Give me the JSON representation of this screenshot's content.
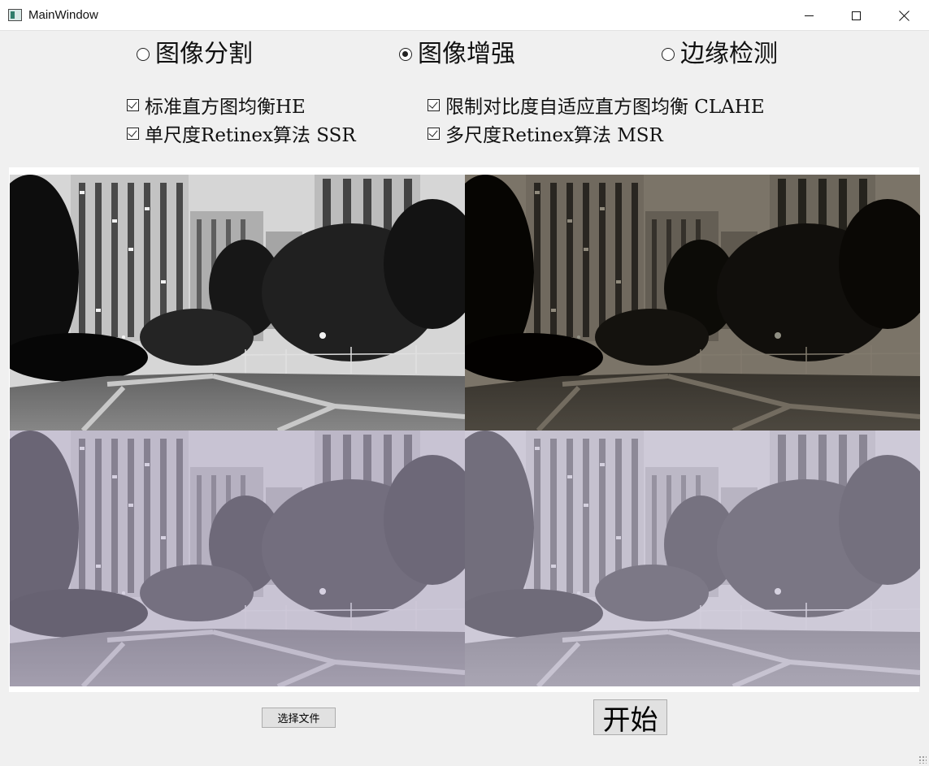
{
  "window": {
    "title": "MainWindow",
    "controls": [
      "minimize-icon",
      "maximize-icon",
      "close-icon"
    ]
  },
  "modes": [
    {
      "label": "图像分割",
      "checked": false
    },
    {
      "label": "图像增强",
      "checked": true
    },
    {
      "label": "边缘检测",
      "checked": false
    }
  ],
  "methods": [
    {
      "label": "标准直方图均衡HE",
      "checked": true
    },
    {
      "label": "限制对比度自适应直方图均衡 CLAHE",
      "checked": true
    },
    {
      "label": "单尺度Retinex算法 SSR",
      "checked": true
    },
    {
      "label": "多尺度Retinex算法 MSR",
      "checked": true
    }
  ],
  "results": [
    {
      "position": "top-left",
      "style": "grayscale high-contrast"
    },
    {
      "position": "top-right",
      "style": "dark natural color"
    },
    {
      "position": "bottom-left",
      "style": "bright washed lavender"
    },
    {
      "position": "bottom-right",
      "style": "bright washed lavender"
    }
  ],
  "buttons": {
    "select_file": "选择文件",
    "start": "开始"
  }
}
